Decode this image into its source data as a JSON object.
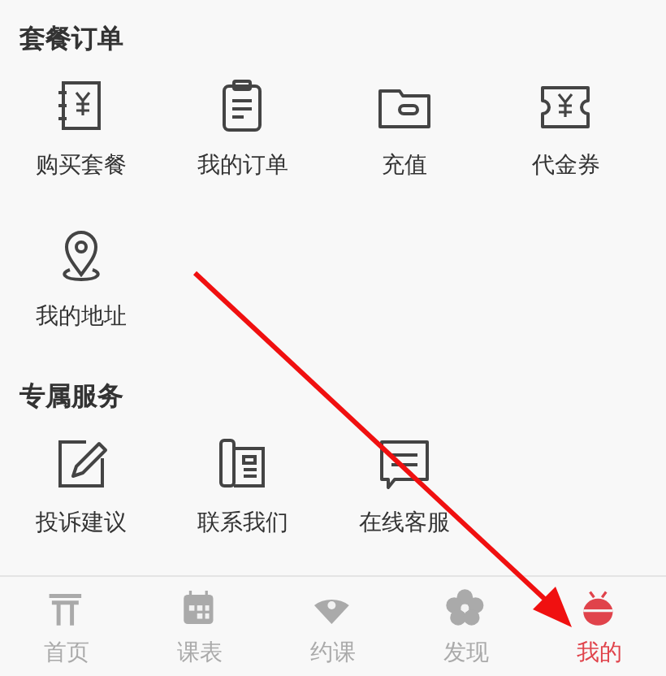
{
  "sections": [
    {
      "title": "套餐订单",
      "items": [
        {
          "label": "购买套餐",
          "kind": "ledger"
        },
        {
          "label": "我的订单",
          "kind": "clipboard"
        },
        {
          "label": "充值",
          "kind": "wallet"
        },
        {
          "label": "代金券",
          "kind": "coupon"
        },
        {
          "label": "我的地址",
          "kind": "pin"
        }
      ]
    },
    {
      "title": "专属服务",
      "items": [
        {
          "label": "投诉建议",
          "kind": "edit"
        },
        {
          "label": "联系我们",
          "kind": "phone"
        },
        {
          "label": "在线客服",
          "kind": "chat"
        }
      ]
    }
  ],
  "tabs": [
    {
      "label": "首页",
      "kind": "gate",
      "selected": false
    },
    {
      "label": "课表",
      "kind": "calendar",
      "selected": false
    },
    {
      "label": "约课",
      "kind": "fan",
      "selected": false
    },
    {
      "label": "发现",
      "kind": "flower",
      "selected": false
    },
    {
      "label": "我的",
      "kind": "bug",
      "selected": true
    }
  ]
}
